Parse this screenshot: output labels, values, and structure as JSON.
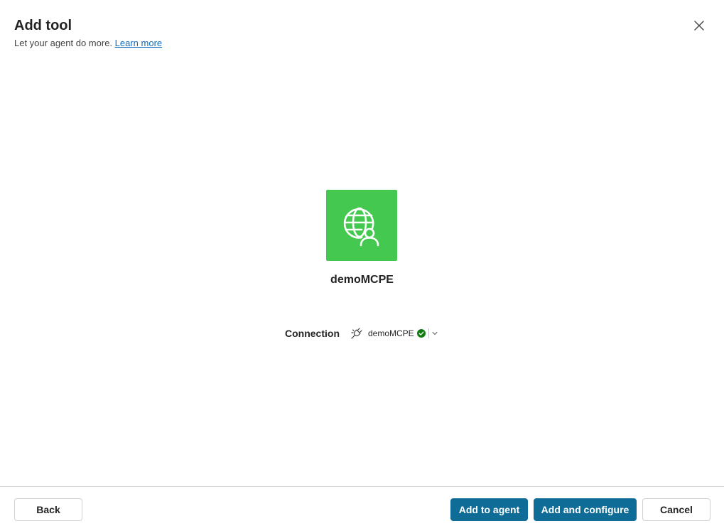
{
  "dialog": {
    "title": "Add tool",
    "subtitle": "Let your agent do more.",
    "learn_more": "Learn more"
  },
  "tool": {
    "name": "demoMCPE",
    "icon": "globe-person-icon",
    "tile_color": "#45c84f"
  },
  "connection": {
    "label": "Connection",
    "selected": "demoMCPE",
    "status": "connected",
    "status_color": "#107c10"
  },
  "footer": {
    "back": "Back",
    "add_to_agent": "Add to agent",
    "add_and_configure": "Add and configure",
    "cancel": "Cancel"
  },
  "colors": {
    "primary": "#0f6c97",
    "link": "#0f6cbd"
  }
}
